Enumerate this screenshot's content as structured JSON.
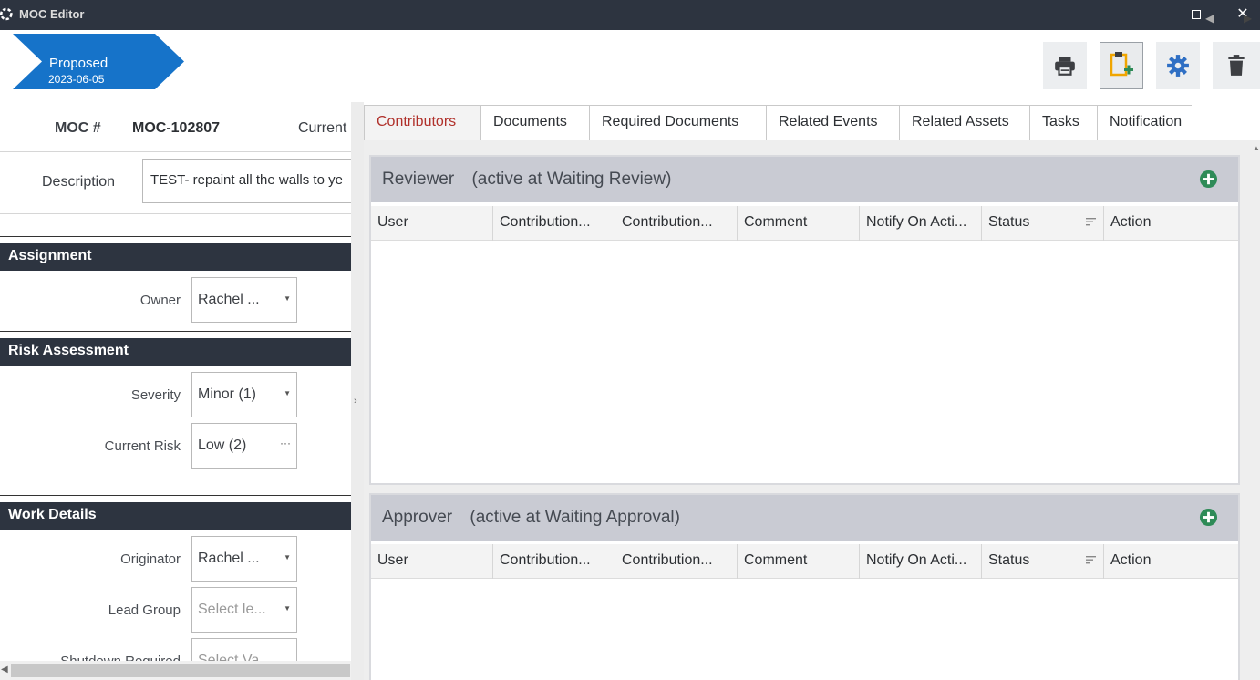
{
  "window": {
    "title": "MOC Editor",
    "maximize_glyph": "□",
    "close_glyph": "✕"
  },
  "status": {
    "label": "Proposed",
    "date": "2023-06-05",
    "color": "#1673c9"
  },
  "toolbar": {
    "icons": [
      "printer-icon",
      "clipboard-add-icon",
      "gear-icon",
      "trash-icon"
    ]
  },
  "header": {
    "moc_label": "MOC #",
    "moc_value": "MOC-102807",
    "current_label": "Current",
    "description_label": "Description",
    "description_value": "TEST- repaint all the walls to ye"
  },
  "sections": {
    "assignment": {
      "title": "Assignment",
      "owner_label": "Owner",
      "owner_value": "Rachel ..."
    },
    "risk": {
      "title": "Risk Assessment",
      "severity_label": "Severity",
      "severity_value": "Minor (1)",
      "current_risk_label": "Current Risk",
      "current_risk_value": "Low (2)"
    },
    "work": {
      "title": "Work Details",
      "originator_label": "Originator",
      "originator_value": "Rachel ...",
      "lead_group_label": "Lead Group",
      "lead_group_placeholder": "Select le...",
      "shutdown_label": "Shutdown Required",
      "shutdown_placeholder": "Select Va..."
    }
  },
  "tabs": [
    {
      "label": "Contributors",
      "active": true
    },
    {
      "label": "Documents",
      "active": false
    },
    {
      "label": "Required Documents",
      "active": false
    },
    {
      "label": "Related Events",
      "active": false
    },
    {
      "label": "Related Assets",
      "active": false
    },
    {
      "label": "Tasks",
      "active": false
    },
    {
      "label": "Notification",
      "active": false
    }
  ],
  "panels": {
    "reviewer": {
      "role": "Reviewer",
      "note": "(active at Waiting Review)"
    },
    "approver": {
      "role": "Approver",
      "note": "(active at Waiting Approval)"
    }
  },
  "grid_columns": [
    "User",
    "Contribution...",
    "Contribution...",
    "Comment",
    "Notify On Acti...",
    "Status",
    "Action"
  ],
  "colors": {
    "titlebar": "#2d3440",
    "accent_tab": "#b0302a",
    "add_icon": "#2e8b57",
    "gear_icon": "#2f6fc4",
    "clipboard_icon": "#f0a500"
  }
}
